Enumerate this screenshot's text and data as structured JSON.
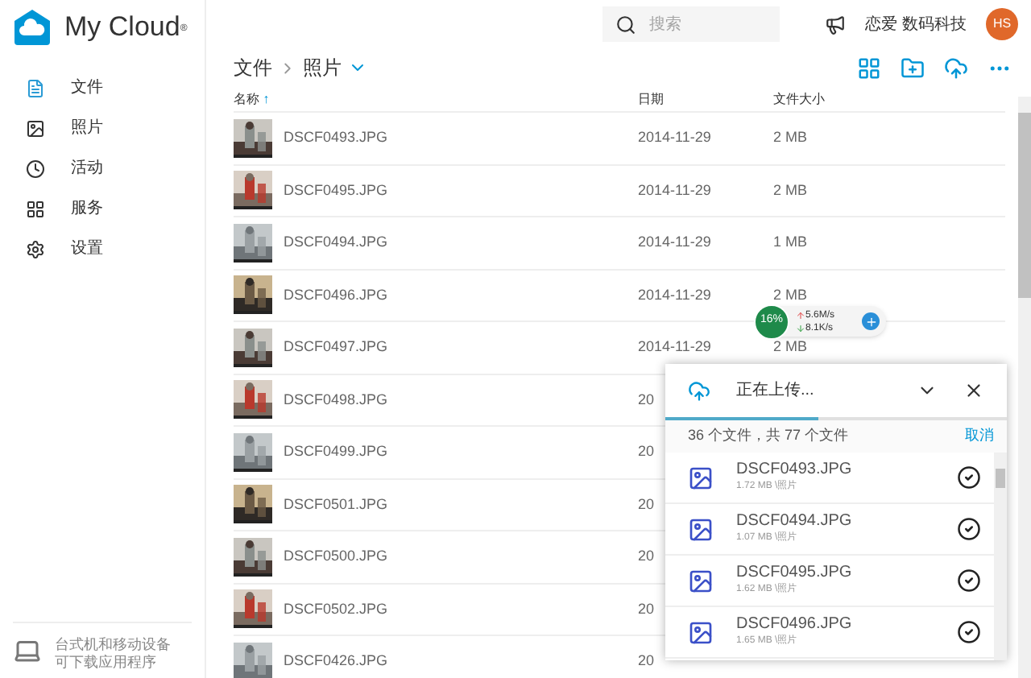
{
  "app": {
    "name": "My Cloud",
    "mark": "®"
  },
  "topbar": {
    "search_placeholder": "搜索",
    "user": "恋爱 数码科技",
    "avatar": "HS"
  },
  "sidebar": {
    "items": [
      {
        "label": "文件",
        "selected": false
      },
      {
        "label": "照片",
        "selected": false
      },
      {
        "label": "活动",
        "selected": false
      },
      {
        "label": "服务",
        "selected": false
      },
      {
        "label": "设置",
        "selected": false
      }
    ],
    "footer": "台式机和移动设备可下载应用程序"
  },
  "breadcrumb": [
    {
      "label": "文件",
      "kind": "link"
    },
    {
      "label": "照片",
      "kind": "current"
    }
  ],
  "table": {
    "columns": [
      "名称",
      "日期",
      "文件大小"
    ],
    "sort_mark": "↑",
    "rows": [
      {
        "name": "DSCF0493.JPG",
        "date": "2014-11-29",
        "size": "2 MB"
      },
      {
        "name": "DSCF0495.JPG",
        "date": "2014-11-29",
        "size": "2 MB"
      },
      {
        "name": "DSCF0494.JPG",
        "date": "2014-11-29",
        "size": "1 MB"
      },
      {
        "name": "DSCF0496.JPG",
        "date": "2014-11-29",
        "size": "2 MB"
      },
      {
        "name": "DSCF0497.JPG",
        "date": "2014-11-29",
        "size": "2 MB"
      },
      {
        "name": "DSCF0498.JPG",
        "date": "20"
      },
      {
        "name": "DSCF0499.JPG",
        "date": "20"
      },
      {
        "name": "DSCF0501.JPG",
        "date": "20"
      },
      {
        "name": "DSCF0500.JPG",
        "date": "20"
      },
      {
        "name": "DSCF0502.JPG",
        "date": "20"
      },
      {
        "name": "DSCF0426.JPG",
        "date": "20"
      }
    ]
  },
  "speed_widget": {
    "percent": "16%",
    "up": "5.6M/s",
    "down": "8.1K/s"
  },
  "upload_panel": {
    "title": "正在上传...",
    "level": 0.45,
    "summary": "36 个文件，共 77 个文件",
    "cancel": "取消",
    "items": [
      {
        "name": "DSCF0493.JPG",
        "detail": "1.72 MB \\照片",
        "done": true
      },
      {
        "name": "DSCF0494.JPG",
        "detail": "1.07 MB \\照片",
        "done": true
      },
      {
        "name": "DSCF0495.JPG",
        "detail": "1.62 MB \\照片",
        "done": true
      },
      {
        "name": "DSCF0496.JPG",
        "detail": "1.65 MB \\照片",
        "done": true
      }
    ]
  }
}
